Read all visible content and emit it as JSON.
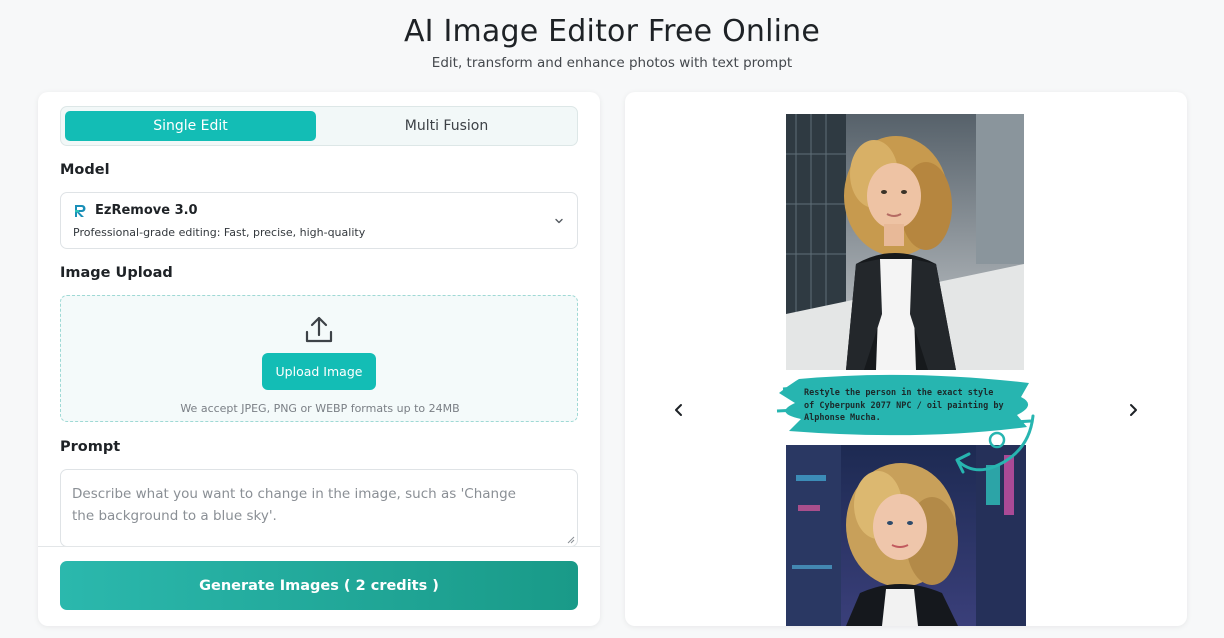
{
  "header": {
    "title": "AI Image Editor Free Online",
    "subtitle": "Edit, transform and enhance photos with text prompt"
  },
  "editor": {
    "tabs": [
      {
        "label": "Single Edit",
        "active": true
      },
      {
        "label": "Multi Fusion",
        "active": false
      }
    ],
    "model": {
      "section_label": "Model",
      "name": "EzRemove 3.0",
      "description": "Professional-grade editing: Fast, precise, high-quality",
      "logo_icon": "ezremove-logo-icon"
    },
    "upload": {
      "section_label": "Image Upload",
      "button_label": "Upload Image",
      "note": "We accept JPEG, PNG or WEBP formats up to 24MB",
      "icon": "upload-icon"
    },
    "prompt": {
      "section_label": "Prompt",
      "placeholder": "Describe what you want to change in the image, such as 'Change the background to a blue sky'.",
      "value": ""
    },
    "generate_button": "Generate Images ( 2 credits )"
  },
  "showcase": {
    "caption": "Restyle the person in the exact style of Cyberpunk 2077 NPC / oil painting by Alphonse Mucha.",
    "prev_icon": "chevron-left-icon",
    "next_icon": "chevron-right-icon"
  },
  "colors": {
    "accent": "#13bdb5",
    "generate_gradient_start": "#2bb8ad",
    "generate_gradient_end": "#199a88",
    "brush": "#27b5b0"
  }
}
